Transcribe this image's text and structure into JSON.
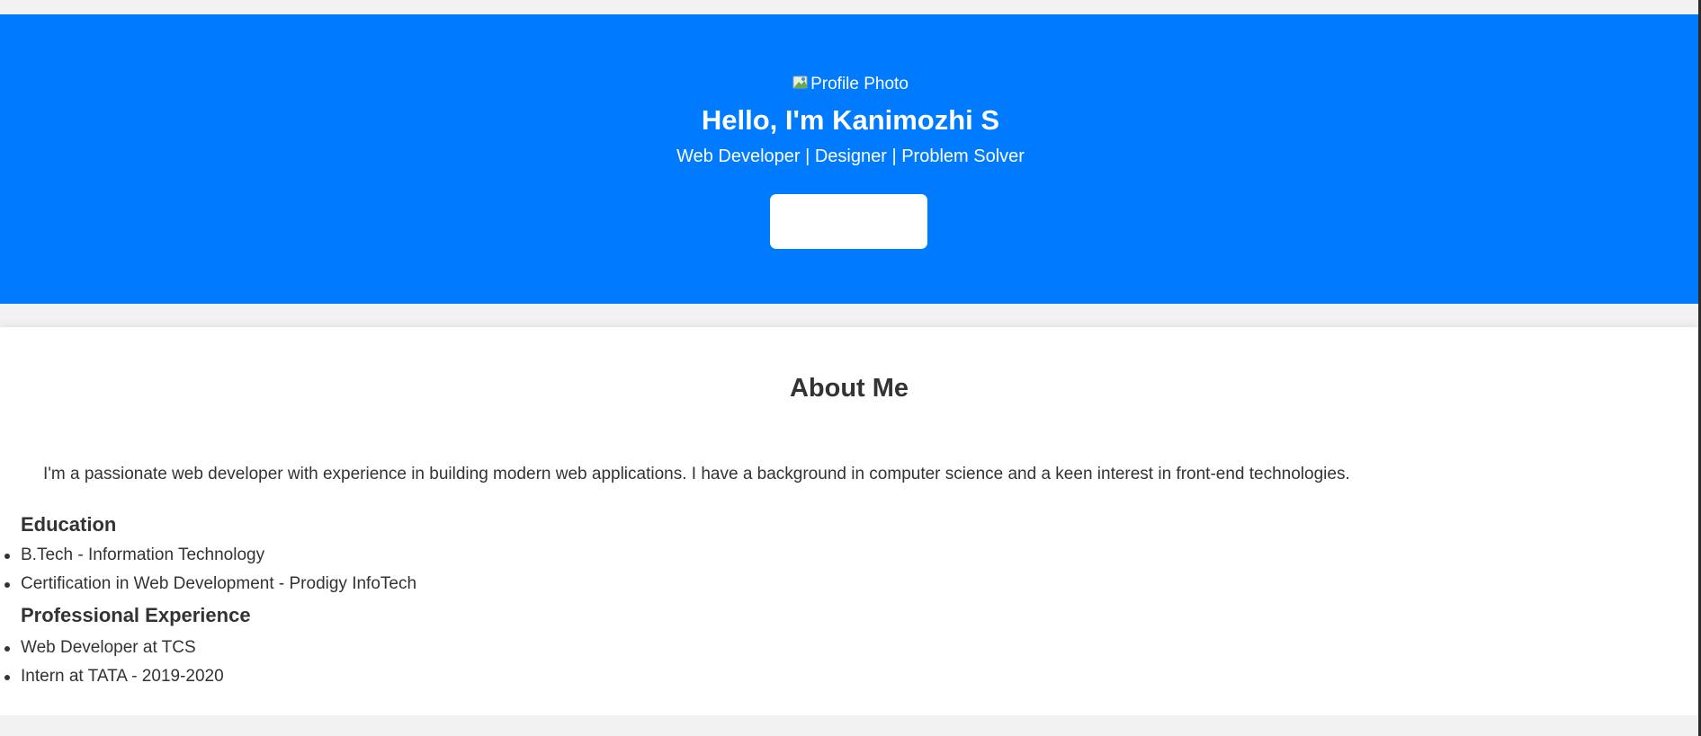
{
  "hero": {
    "profile_photo_alt": "Profile Photo",
    "title": "Hello, I'm Kanimozhi S",
    "subtitle": "Web Developer | Designer | Problem Solver",
    "cta_label": "",
    "background_color": "#007bff"
  },
  "about": {
    "title": "About Me",
    "text": "I'm a passionate web developer with experience in building modern web applications. I have a background in computer science and a keen interest in front-end technologies.",
    "education": {
      "heading": "Education",
      "items": [
        {
          "label": "B.Tech - Information Technology"
        },
        {
          "label": "Certification in Web Development - Prodigy InfoTech"
        }
      ]
    },
    "experience": {
      "heading": "Professional Experience",
      "items": [
        {
          "label": "Web Developer at TCS"
        },
        {
          "label": "Intern at TATA - 2019-2020"
        }
      ]
    }
  },
  "icons": {
    "profile_photo": "broken-image-icon"
  }
}
